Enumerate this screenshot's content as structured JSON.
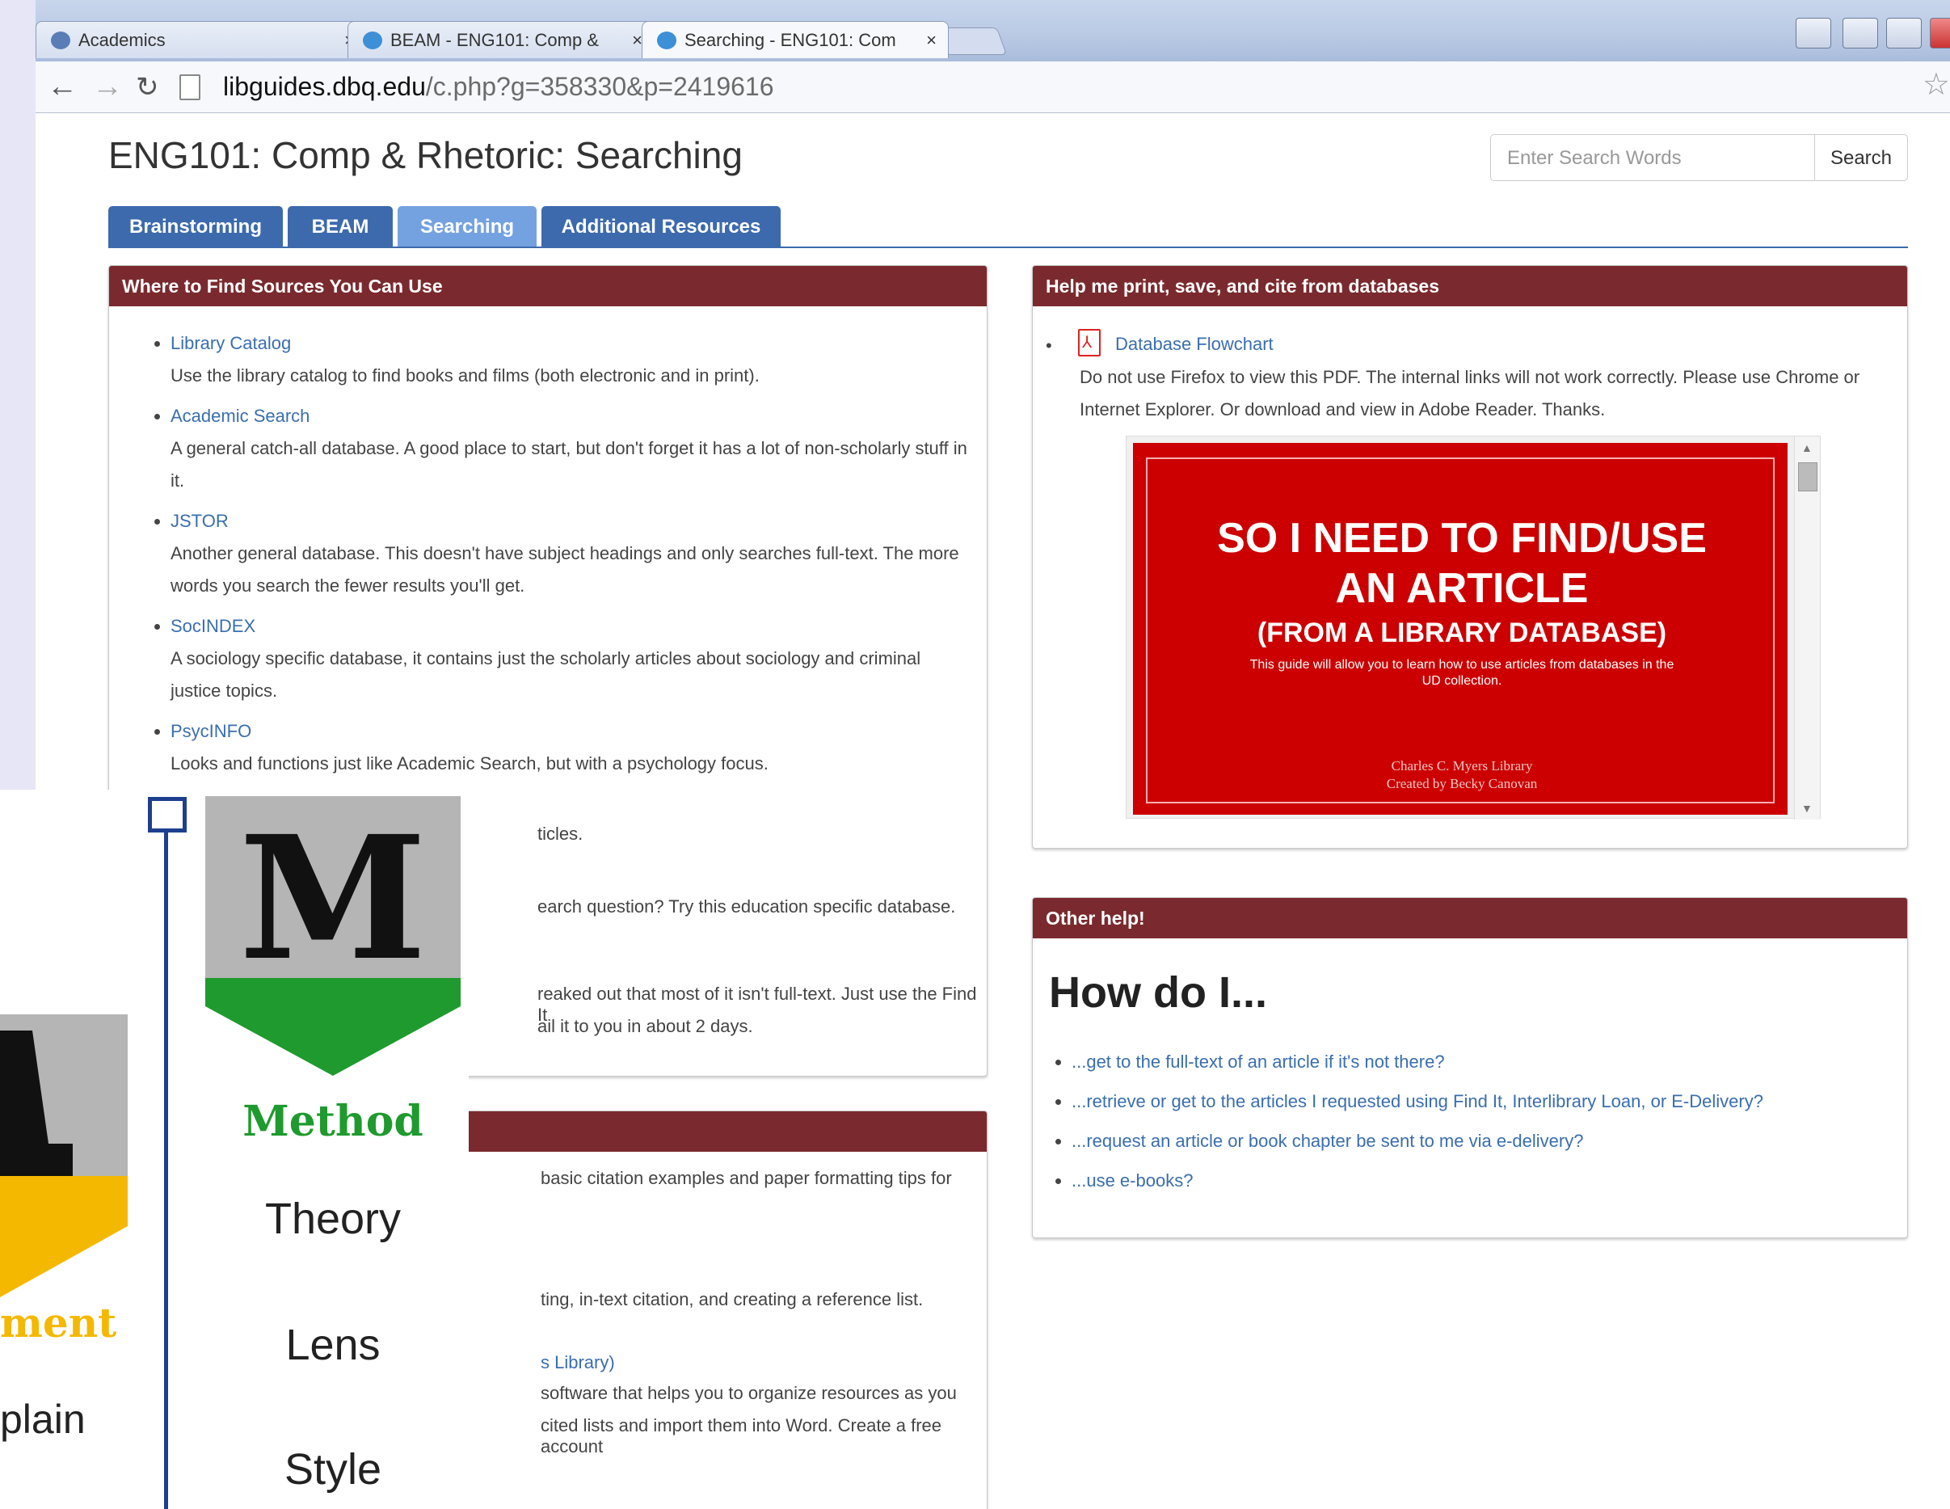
{
  "browser": {
    "tabs": [
      {
        "label": "Academics"
      },
      {
        "label": "BEAM - ENG101: Comp &"
      },
      {
        "label": "Searching - ENG101: Com"
      }
    ],
    "url_host": "libguides.dbq.edu",
    "url_path": "/c.php?g=358330&p=2419616",
    "close_glyph": "×"
  },
  "page": {
    "title": "ENG101: Comp & Rhetoric: Searching",
    "search_placeholder": "Enter Search Words",
    "search_button": "Search",
    "nav_tabs": [
      "Brainstorming",
      "BEAM",
      "Searching",
      "Additional Resources"
    ],
    "active_tab": "Searching"
  },
  "sources_box": {
    "heading": "Where to Find Sources You Can Use",
    "items": [
      {
        "title": "Library Catalog",
        "desc": "Use the library catalog to find books and films (both electronic and in print)."
      },
      {
        "title": "Academic Search",
        "desc": "A general catch-all database. A good place to start, but don't forget it has a lot of non-scholarly stuff in it."
      },
      {
        "title": "JSTOR",
        "desc": "Another general database. This doesn't have subject headings and only searches full-text. The more words you search the fewer results you'll get."
      },
      {
        "title": "SocINDEX",
        "desc": "A sociology specific database, it contains just the scholarly articles about sociology and criminal justice topics."
      },
      {
        "title": "PsycINFO",
        "desc": "Looks and functions just like Academic Search, but with a psychology focus."
      }
    ],
    "partial_lines": [
      "ticles.",
      "earch question? Try this education specific database.",
      "reaked out that most of it isn't full-text. Just use the Find It",
      "ail it to you in about 2 days."
    ]
  },
  "citation_box": {
    "partial_lines": [
      "basic citation examples and paper formatting tips for",
      "ting, in-text citation, and creating a reference list.",
      "s Library)",
      "software that helps you to organize resources as you",
      "cited lists and import them into Word. Create a free account"
    ]
  },
  "print_box": {
    "heading": "Help me print, save, and cite from databases",
    "link": "Database Flowchart",
    "desc": "Do not use Firefox to view this PDF. The internal links will not work correctly. Please use Chrome or Internet Explorer. Or download and view in Adobe Reader. Thanks.",
    "pdf": {
      "line1": "SO I NEED TO FIND/USE",
      "line2": "AN ARTICLE",
      "line3": "(FROM A LIBRARY DATABASE)",
      "line4": "This guide will allow you to learn how to use articles from databases in the",
      "line5": "UD collection.",
      "credit1": "Charles C. Myers Library",
      "credit2": "Created by Becky Canovan"
    }
  },
  "help_box": {
    "heading": "Other help!",
    "subheading": "How do I...",
    "items": [
      "...get to the full-text of an article if it's not there?",
      "...retrieve or get to the articles I requested using Find It, Interlibrary Loan, or E-Delivery?",
      "...request an article or book chapter be sent to me via e-delivery?",
      "...use e-books?"
    ]
  },
  "overlay": {
    "logo_letter": "M",
    "word_method": "Method",
    "word_theory": "Theory",
    "word_lens": "Lens",
    "word_style": "Style",
    "left_word1": "ment",
    "left_word2": "plain"
  },
  "colors": {
    "tab_blue": "#3c6aad",
    "tab_active": "#74a2e0",
    "box_head": "#7a2a2e",
    "link": "#3a6eaf",
    "method_green": "#1f9a2e",
    "argument_yellow": "#f5b800"
  }
}
